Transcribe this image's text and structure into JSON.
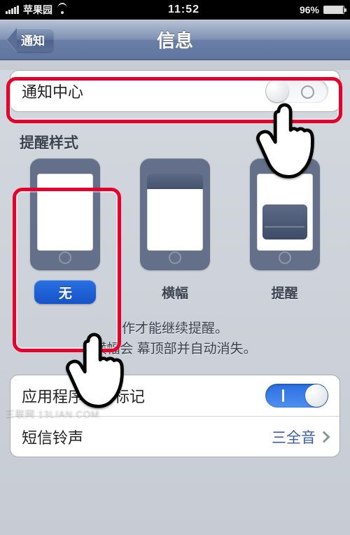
{
  "status": {
    "carrier": "苹果园",
    "time": "11:52",
    "battery_pct": "96%"
  },
  "nav": {
    "back_label": "通知",
    "title": "信息"
  },
  "notification_center": {
    "label": "通知中心",
    "state": "off"
  },
  "alert_style": {
    "header": "提醒样式",
    "options": [
      {
        "label": "无",
        "selected": true
      },
      {
        "label": "横幅",
        "selected": false
      },
      {
        "label": "提醒",
        "selected": false
      }
    ],
    "help_line1": "作才能继续提醒。",
    "help_line2": "横幅会                  幕顶部并自动消失。"
  },
  "badge": {
    "label": "应用程序图标标记",
    "state": "on"
  },
  "sound": {
    "label": "短信铃声",
    "value": "三全音"
  },
  "watermark": "三联网 13LIAN.COM"
}
